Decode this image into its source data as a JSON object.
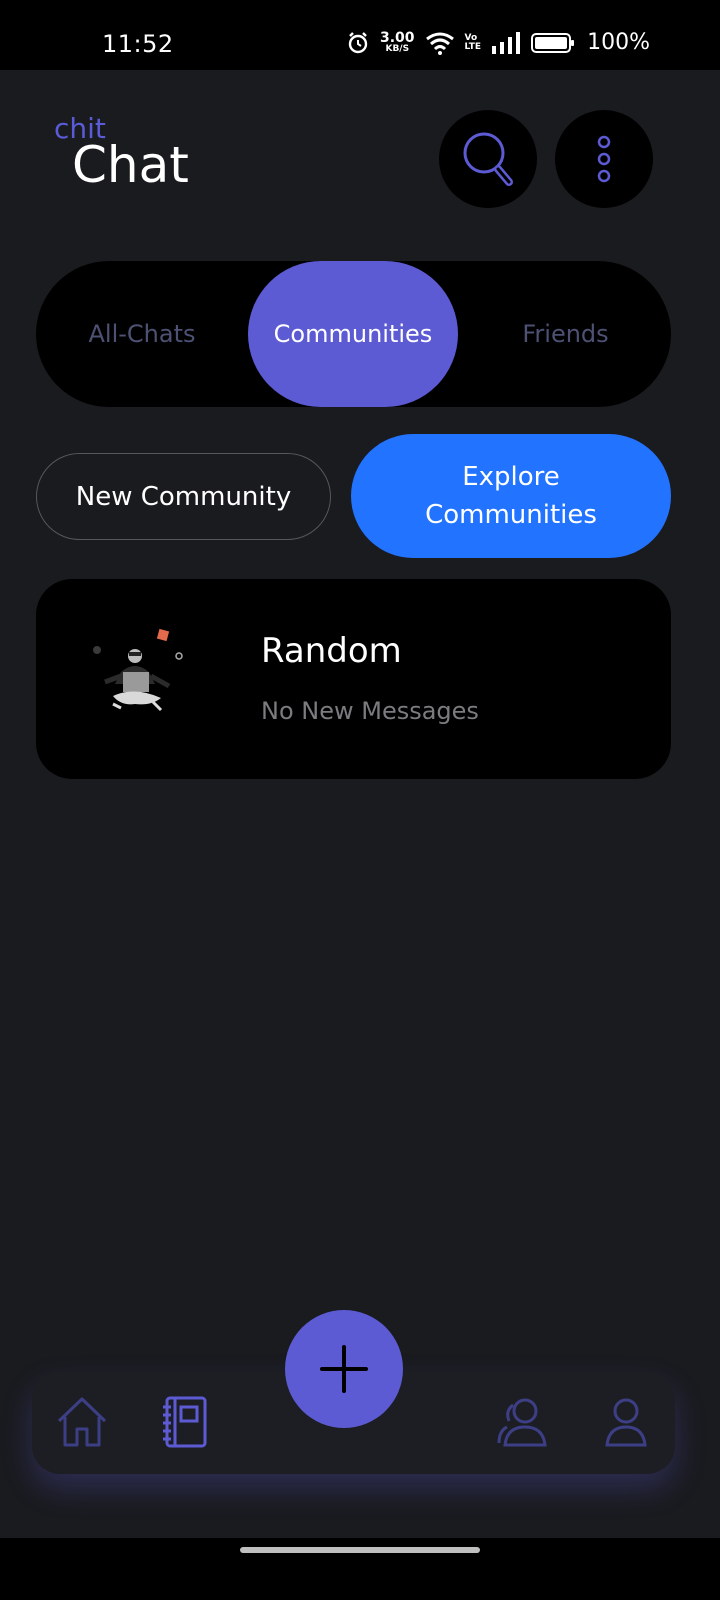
{
  "status_bar": {
    "time": "11:52",
    "speed_value": "3.00",
    "speed_unit": "KB/S",
    "volte_top": "Vo",
    "volte_bottom": "LTE",
    "battery": "100%"
  },
  "header": {
    "brand_small": "chit",
    "brand_big": "Chat",
    "search_icon": "search-icon",
    "menu_icon": "more-vertical-icon"
  },
  "tabs": [
    {
      "label": "All-Chats",
      "active": false
    },
    {
      "label": "Communities",
      "active": true
    },
    {
      "label": "Friends",
      "active": false
    }
  ],
  "actions": {
    "new_community": "New Community",
    "explore_line1": "Explore",
    "explore_line2": "Communities"
  },
  "communities": [
    {
      "name": "Random",
      "subtitle": "No New Messages"
    }
  ],
  "bottom_nav": {
    "items": [
      "home-icon",
      "notebook-icon",
      "add-icon",
      "contacts-icon",
      "profile-icon"
    ]
  },
  "colors": {
    "background": "#1a1b1f",
    "accent": "#5d5bd4",
    "explore_blue": "#2273ff",
    "inactive_tab": "#4d5173"
  }
}
